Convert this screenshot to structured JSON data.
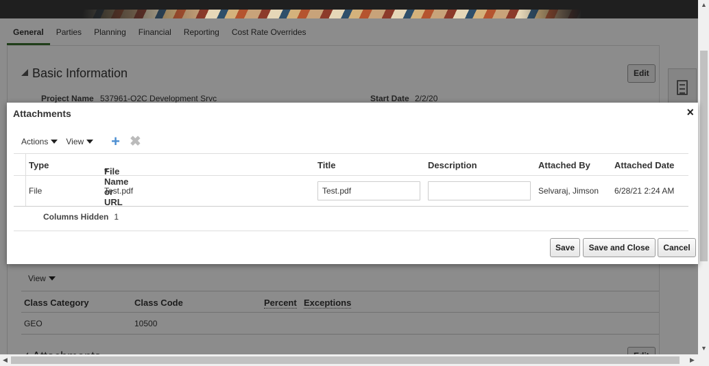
{
  "tabs": [
    "General",
    "Parties",
    "Planning",
    "Financial",
    "Reporting",
    "Cost Rate Overrides"
  ],
  "basic_info": {
    "title": "Basic Information",
    "edit_label": "Edit",
    "project_name_label": "Project Name",
    "project_name": "537961-O2C Development Srvc",
    "start_date_label": "Start Date",
    "start_date": "2/2/20"
  },
  "classifications": {
    "view_label": "View",
    "columns": [
      "Class Category",
      "Class Code",
      "Percent",
      "Exceptions"
    ],
    "rows": [
      {
        "category": "GEO",
        "code": "10500"
      }
    ]
  },
  "bg_attachments": {
    "title": "Attachments",
    "edit_label": "Edit"
  },
  "dialog": {
    "title": "Attachments",
    "close": "×",
    "toolbar": {
      "actions": "Actions",
      "view": "View",
      "add": "+",
      "delete": "✖"
    },
    "columns": {
      "type": "Type",
      "file_required": "*",
      "file": "File Name or URL",
      "title": "Title",
      "description": "Description",
      "attached_by": "Attached By",
      "attached_date": "Attached Date"
    },
    "rows": [
      {
        "type": "File",
        "file": "Test.pdf",
        "title": "Test.pdf",
        "description": "",
        "attached_by": "Selvaraj, Jimson",
        "attached_date": "6/28/21 2:24 AM"
      }
    ],
    "columns_hidden_label": "Columns Hidden",
    "columns_hidden_count": "1",
    "buttons": {
      "save": "Save",
      "save_close": "Save and Close",
      "cancel": "Cancel"
    }
  }
}
